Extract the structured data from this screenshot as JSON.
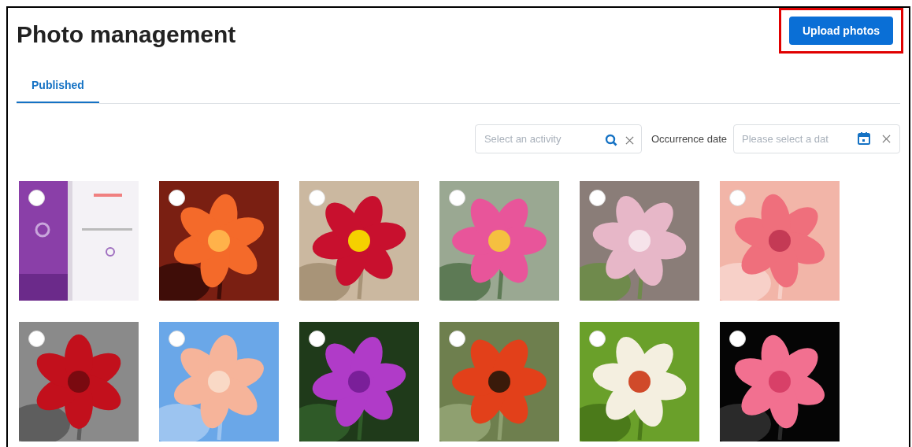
{
  "page": {
    "title": "Photo management"
  },
  "upload_button": {
    "label": "Upload photos",
    "highlighted": true
  },
  "tabs": [
    {
      "label": "Published",
      "selected": true
    }
  ],
  "filters": {
    "activity": {
      "placeholder": "Select an activity"
    },
    "date_label": "Occurrence date",
    "date": {
      "placeholder": "Please select a dat"
    }
  }
}
